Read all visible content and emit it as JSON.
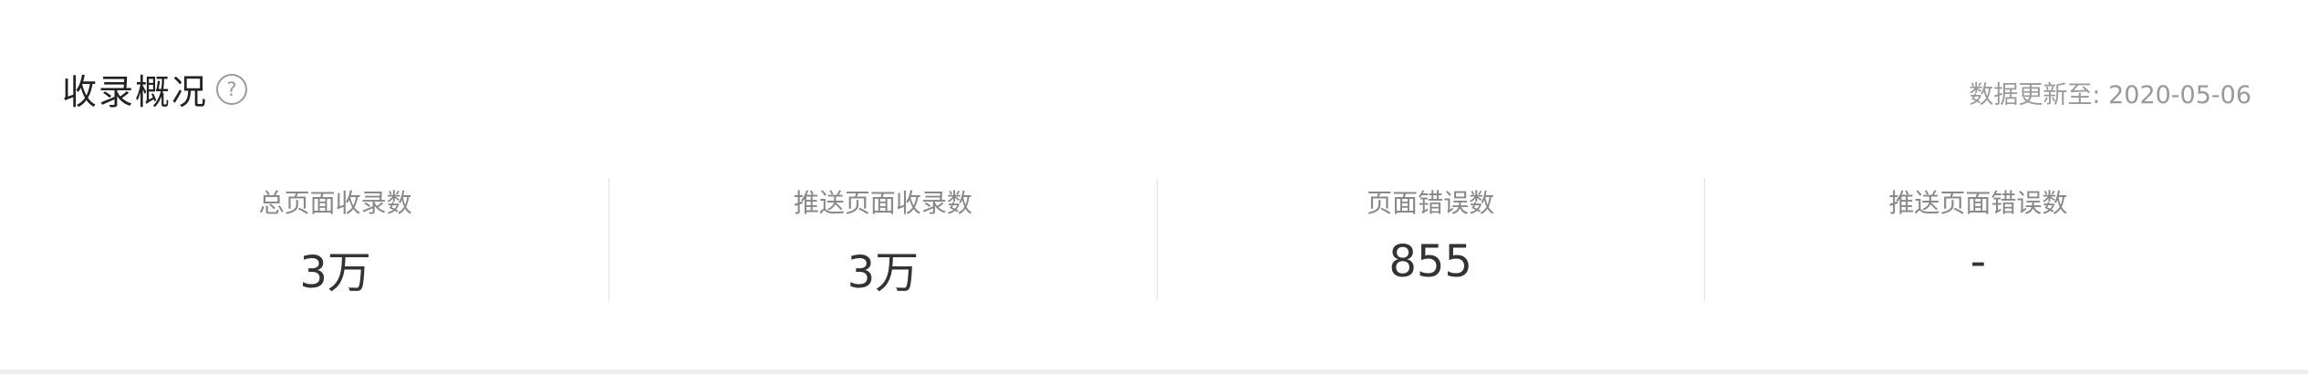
{
  "header": {
    "title": "收录概况",
    "help_icon": "question-circle-icon",
    "update_label": "数据更新至: 2020-05-06"
  },
  "stats": [
    {
      "label": "总页面收录数",
      "value": "3万"
    },
    {
      "label": "推送页面收录数",
      "value": "3万"
    },
    {
      "label": "页面错误数",
      "value": "855"
    },
    {
      "label": "推送页面错误数",
      "value": "-"
    }
  ],
  "colors": {
    "title": "#222222",
    "muted": "#999999",
    "label": "#888888",
    "value": "#333333",
    "divider": "#e3e3e3"
  }
}
